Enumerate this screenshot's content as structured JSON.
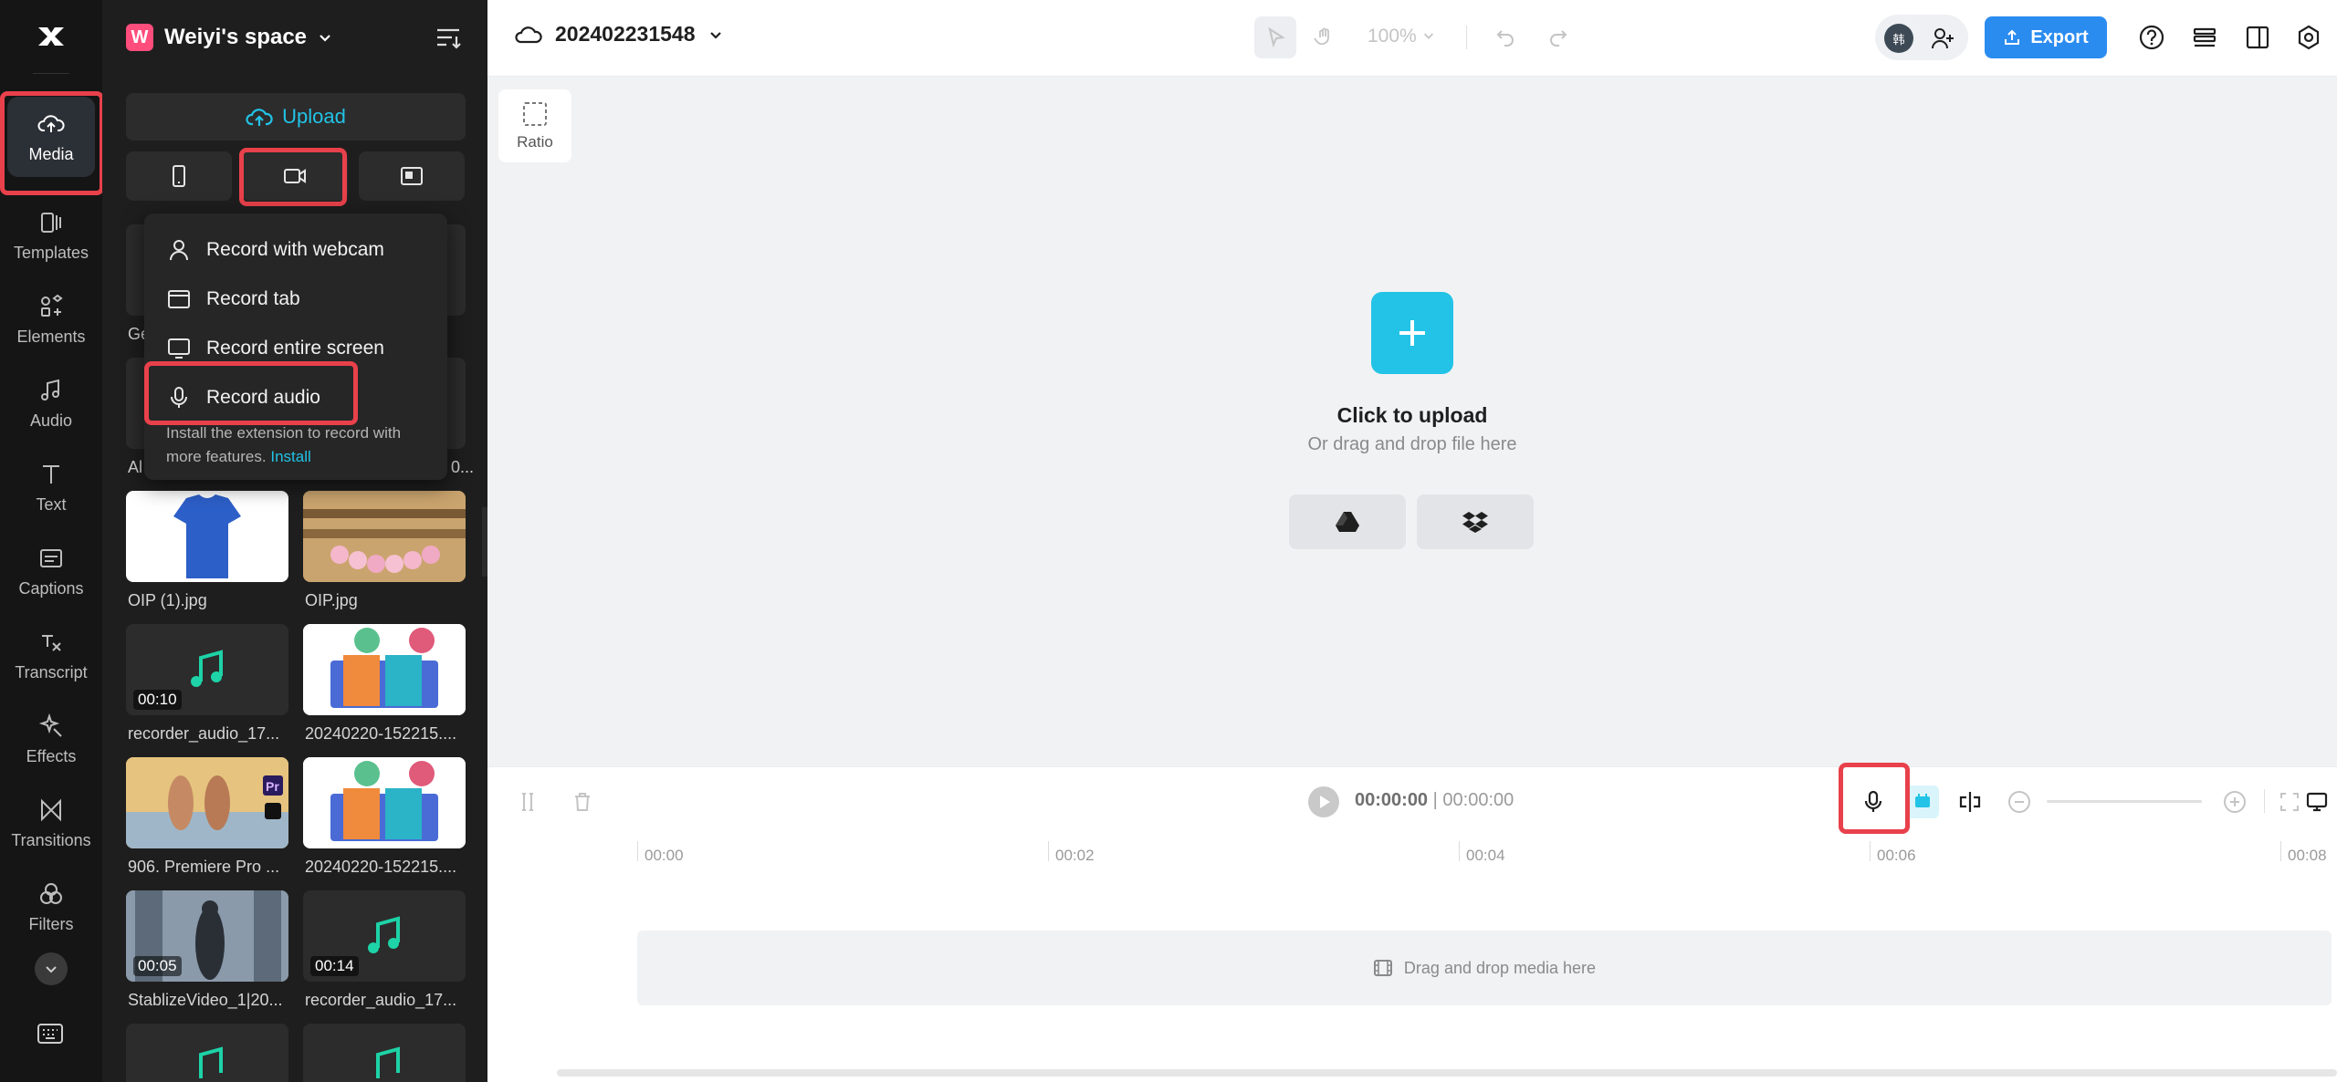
{
  "rail": {
    "items": [
      {
        "label": "Media",
        "icon": "cloud-upload-icon"
      },
      {
        "label": "Templates",
        "icon": "templates-icon"
      },
      {
        "label": "Elements",
        "icon": "elements-icon"
      },
      {
        "label": "Audio",
        "icon": "music-note-icon"
      },
      {
        "label": "Text",
        "icon": "text-icon"
      },
      {
        "label": "Captions",
        "icon": "captions-icon"
      },
      {
        "label": "Transcript",
        "icon": "transcript-icon"
      },
      {
        "label": "Effects",
        "icon": "effects-icon"
      },
      {
        "label": "Transitions",
        "icon": "transitions-icon"
      },
      {
        "label": "Filters",
        "icon": "filters-icon"
      }
    ]
  },
  "panel": {
    "space_initial": "W",
    "space_name": "Weiyi's space",
    "upload_label": "Upload",
    "partial_labels": [
      "Ge",
      "Al",
      "0..."
    ],
    "media": [
      {
        "label": "OIP (1).jpg",
        "kind": "tshirt"
      },
      {
        "label": "OIP.jpg",
        "kind": "bracelet"
      },
      {
        "label": "recorder_audio_17...",
        "kind": "audio",
        "duration": "00:10"
      },
      {
        "label": "20240220-152215....",
        "kind": "promo"
      },
      {
        "label": "906. Premiere Pro ...",
        "kind": "runners",
        "badge": "Pr"
      },
      {
        "label": "20240220-152215....",
        "kind": "promo"
      },
      {
        "label": "StablizeVideo_1|20...",
        "kind": "city",
        "duration": "00:05"
      },
      {
        "label": "recorder_audio_17...",
        "kind": "audio",
        "duration": "00:14"
      },
      {
        "label": "",
        "kind": "audio"
      },
      {
        "label": "",
        "kind": "audio"
      }
    ]
  },
  "record_menu": {
    "items": [
      {
        "label": "Record with webcam",
        "icon": "person-icon"
      },
      {
        "label": "Record tab",
        "icon": "browser-tab-icon"
      },
      {
        "label": "Record entire screen",
        "icon": "monitor-icon"
      },
      {
        "label": "Record audio",
        "icon": "microphone-icon"
      }
    ],
    "note": "Install the extension to record with more features.",
    "install_link": "Install"
  },
  "topbar": {
    "project_name": "202402231548",
    "zoom": "100%",
    "avatar_text": "韩",
    "export_label": "Export"
  },
  "canvas": {
    "ratio_label": "Ratio",
    "click_to_upload": "Click to upload",
    "drag_drop": "Or drag and drop file here"
  },
  "timeline": {
    "current_time": "00:00:00",
    "separator": "|",
    "total_time": "00:00:00",
    "ticks": [
      "00:00",
      "00:02",
      "00:04",
      "00:06",
      "00:08"
    ],
    "drop_hint": "Drag and drop media here"
  },
  "colors": {
    "accent": "#22c3e6",
    "export": "#2b8cf0",
    "highlight": "#e8414b",
    "rail_bg": "#151515",
    "panel_bg": "#1e1e1e"
  }
}
